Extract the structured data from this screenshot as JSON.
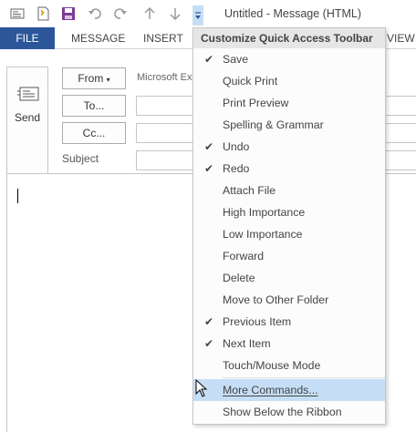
{
  "window": {
    "title": "Untitled - Message (HTML)"
  },
  "ribbon": {
    "tabs": [
      {
        "label": "FILE"
      },
      {
        "label": "MESSAGE"
      },
      {
        "label": "INSERT"
      },
      {
        "label": "VIEW"
      }
    ],
    "visible_tab_fragment": "VIEW"
  },
  "compose": {
    "send_label": "Send",
    "from_label": "From",
    "from_value": "Microsoft Ex",
    "to_label": "To...",
    "cc_label": "Cc...",
    "subject_label": "Subject"
  },
  "menu": {
    "header": "Customize Quick Access Toolbar",
    "items": [
      {
        "label": "Save",
        "checked": true
      },
      {
        "label": "Quick Print",
        "checked": false
      },
      {
        "label": "Print Preview",
        "checked": false
      },
      {
        "label": "Spelling & Grammar",
        "checked": false
      },
      {
        "label": "Undo",
        "checked": true
      },
      {
        "label": "Redo",
        "checked": true
      },
      {
        "label": "Attach File",
        "checked": false
      },
      {
        "label": "High Importance",
        "checked": false
      },
      {
        "label": "Low Importance",
        "checked": false
      },
      {
        "label": "Forward",
        "checked": false
      },
      {
        "label": "Delete",
        "checked": false
      },
      {
        "label": "Move to Other Folder",
        "checked": false
      },
      {
        "label": "Previous Item",
        "checked": true
      },
      {
        "label": "Next Item",
        "checked": true
      },
      {
        "label": "Touch/Mouse Mode",
        "checked": false
      }
    ],
    "more_commands": "More Commands...",
    "show_below": "Show Below the Ribbon"
  },
  "icons": {
    "qat": [
      "mail-icon",
      "sticky-note-icon",
      "save-icon",
      "undo-icon",
      "redo-icon",
      "up-arrow-icon",
      "down-arrow-icon",
      "customize-dropdown-icon"
    ]
  },
  "colors": {
    "file_tab": "#2b579a",
    "menu_hover": "#c5def5",
    "save_icon": "#7d3b94"
  }
}
